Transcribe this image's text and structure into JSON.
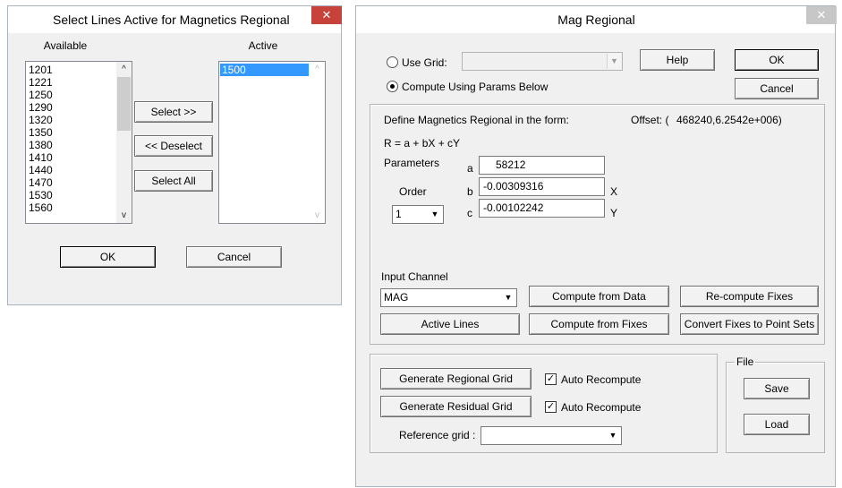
{
  "select_lines_dialog": {
    "title": "Select Lines Active for Magnetics Regional",
    "close_glyph": "✕",
    "available_header": "Available",
    "active_header": "Active",
    "available_items": [
      "1201",
      "1221",
      "1250",
      "1290",
      "1320",
      "1350",
      "1380",
      "1410",
      "1440",
      "1470",
      "1530",
      "1560"
    ],
    "active_items": [
      "1500"
    ],
    "select_button": "Select >>",
    "deselect_button": "<< Deselect",
    "select_all_button": "Select All",
    "ok_button": "OK",
    "cancel_button": "Cancel"
  },
  "mag_regional_dialog": {
    "title": "Mag Regional",
    "close_glyph": "✕",
    "use_grid_label": "Use Grid:",
    "use_grid_selected": false,
    "compute_params_label": "Compute Using Params Below",
    "compute_params_selected": true,
    "use_grid_value": "",
    "help_button": "Help",
    "ok_button": "OK",
    "cancel_button": "Cancel",
    "define_text": "Define Magnetics Regional in the form:",
    "offset_label": "Offset: (",
    "offset_value": "468240,6.2542e+006)",
    "formula": "R = a + bX + cY",
    "parameters_label": "Parameters",
    "order_label": "Order",
    "order_value": "1",
    "param_a_label": "a",
    "param_a_value": "58212",
    "param_b_label": "b",
    "param_b_value": "-0.00309316",
    "param_b_suffix": "X",
    "param_c_label": "c",
    "param_c_value": "-0.00102242",
    "param_c_suffix": "Y",
    "input_channel_label": "Input Channel",
    "input_channel_value": "MAG",
    "compute_from_data_button": "Compute from Data",
    "recompute_fixes_button": "Re-compute Fixes",
    "active_lines_button": "Active Lines",
    "compute_from_fixes_button": "Compute from Fixes",
    "convert_fixes_button": "Convert Fixes to Point Sets",
    "generate_regional_button": "Generate Regional Grid",
    "generate_residual_button": "Generate Residual Grid",
    "auto_recompute_label_1": "Auto Recompute",
    "auto_recompute_label_2": "Auto Recompute",
    "auto_recompute_1_checked": true,
    "auto_recompute_2_checked": true,
    "reference_grid_label": "Reference grid :",
    "reference_grid_value": "",
    "file_group_label": "File",
    "save_button": "Save",
    "load_button": "Load"
  },
  "glyphs": {
    "check": "✓",
    "dropdown": "▼",
    "scroll_up": "^",
    "scroll_down": "v"
  }
}
